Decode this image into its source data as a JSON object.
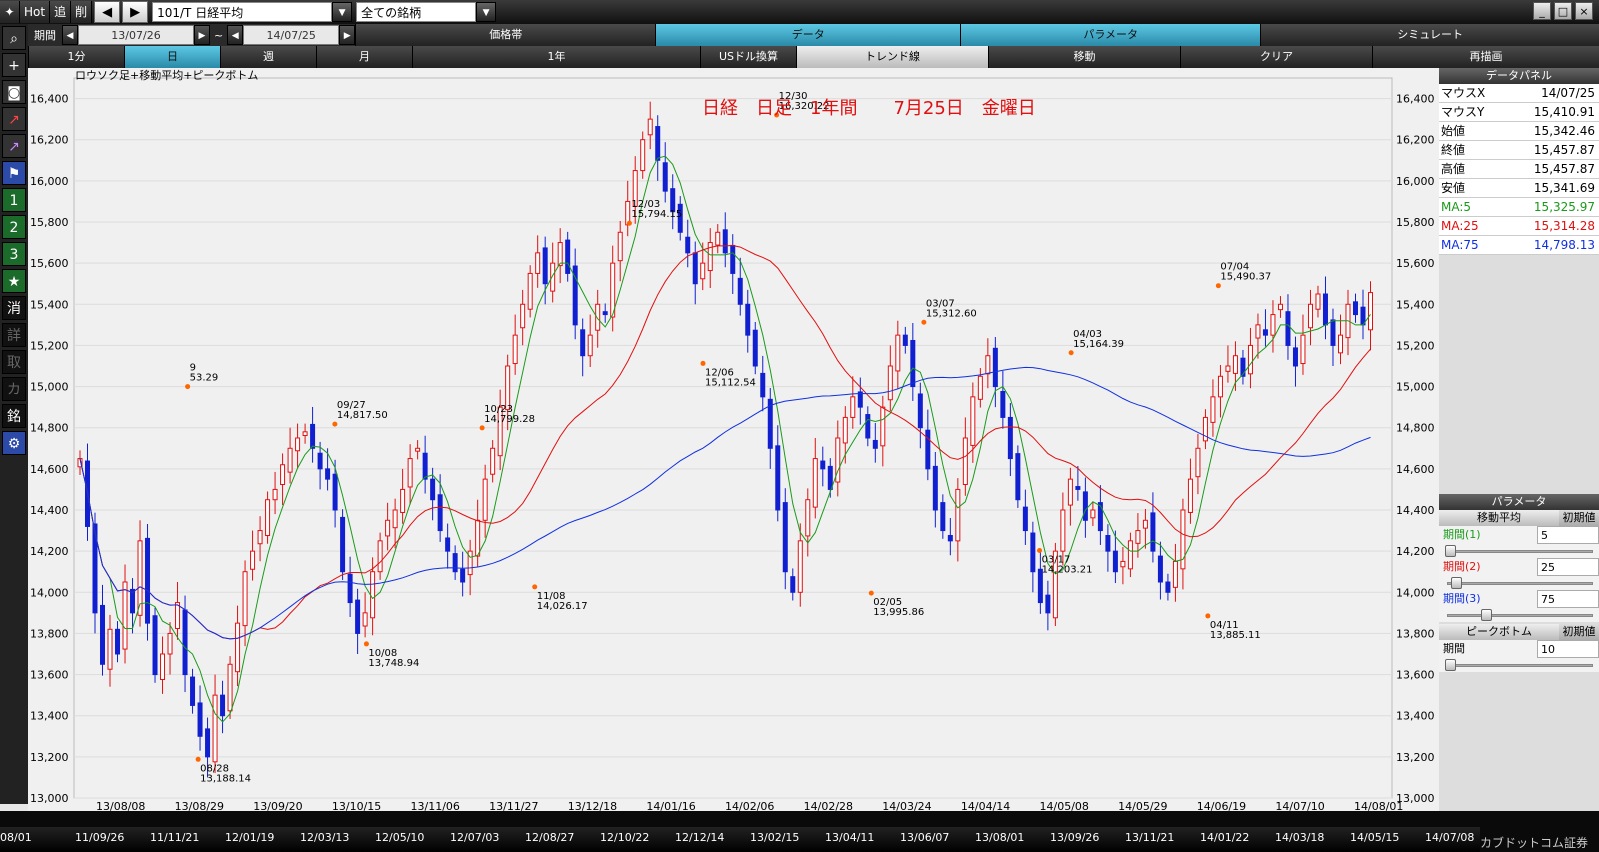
{
  "toolbar": {
    "hot": "Hot",
    "add": "追",
    "del": "削",
    "symbol": "101/T 日経平均",
    "list": "全ての銘柄"
  },
  "range": {
    "label": "期間",
    "from": "13/07/26",
    "tilde": "~",
    "to": "14/07/25"
  },
  "tabs_top": [
    "価格帯",
    "データ",
    "パラメータ",
    "シミュレート"
  ],
  "tabs_bottom": [
    "1分",
    "日",
    "週",
    "月",
    "1年",
    "USドル換算",
    "トレンド線",
    "移動",
    "クリア",
    "再描画"
  ],
  "sidebar": [
    "1",
    "2",
    "3",
    "★",
    "消",
    "詳",
    "取",
    "カ",
    "銘"
  ],
  "chart": {
    "caption": "ロウソク足+移動平均+ピークボトム",
    "title": "日経　日足　1年間　　7月25日　金曜日",
    "y_ticks": [
      "16,400",
      "16,200",
      "16,000",
      "15,800",
      "15,600",
      "15,400",
      "15,200",
      "15,000",
      "14,800",
      "14,600",
      "14,400",
      "14,200",
      "14,000",
      "13,800",
      "13,600",
      "13,400",
      "13,200",
      "13,000"
    ],
    "x_ticks": [
      "13/08/08",
      "13/08/29",
      "13/09/20",
      "13/10/15",
      "13/11/06",
      "13/11/27",
      "13/12/18",
      "14/01/16",
      "14/02/06",
      "14/02/28",
      "14/03/24",
      "14/04/14",
      "14/05/08",
      "14/05/29",
      "14/06/19",
      "14/07/10",
      "14/08/01"
    ],
    "peaks": [
      {
        "date": "9",
        "value": "53.29"
      },
      {
        "date": "09/27",
        "value": "14,817.50"
      },
      {
        "date": "10/23",
        "value": "14,799.28"
      },
      {
        "date": "12/03",
        "value": "15,794.15"
      },
      {
        "date": "12/30",
        "value": "16,320.22"
      },
      {
        "date": "03/07",
        "value": "15,312.60"
      },
      {
        "date": "04/03",
        "value": "15,164.39"
      },
      {
        "date": "07/04",
        "value": "15,490.37"
      }
    ],
    "bottoms": [
      {
        "date": "08/28",
        "value": "13,188.14"
      },
      {
        "date": "10/08",
        "value": "13,748.94"
      },
      {
        "date": "11/08",
        "value": "14,026.17"
      },
      {
        "date": "12/06",
        "value": "15,112.54"
      },
      {
        "date": "02/05",
        "value": "13,995.86"
      },
      {
        "date": "03/17",
        "value": "14,203.21"
      },
      {
        "date": "04/11",
        "value": "13,885.11"
      }
    ]
  },
  "data_panel": {
    "title": "データパネル",
    "rows": [
      {
        "k": "マウスX",
        "v": "14/07/25"
      },
      {
        "k": "マウスY",
        "v": "15,410.91"
      },
      {
        "k": "始値",
        "v": "15,342.46"
      },
      {
        "k": "終値",
        "v": "15,457.87"
      },
      {
        "k": "高値",
        "v": "15,457.87"
      },
      {
        "k": "安値",
        "v": "15,341.69"
      },
      {
        "k": "MA:5",
        "v": "15,325.97",
        "color": "#1a9a1a"
      },
      {
        "k": "MA:25",
        "v": "15,314.28",
        "color": "#e01010"
      },
      {
        "k": "MA:75",
        "v": "14,798.13",
        "color": "#1030e0"
      }
    ]
  },
  "param_panel": {
    "title": "パラメータ",
    "ma_label": "移動平均",
    "reset": "初期値",
    "p1_label": "期間(1)",
    "p1": "5",
    "p2_label": "期間(2)",
    "p2": "25",
    "p3_label": "期間(3)",
    "p3": "75",
    "pb_label": "ピークボトム",
    "pb_reset": "初期値",
    "pb_period_label": "期間",
    "pb_period": "10"
  },
  "timeline": [
    "08/01",
    "11/09/26",
    "11/11/21",
    "12/01/19",
    "12/03/13",
    "12/05/10",
    "12/07/03",
    "12/08/27",
    "12/10/22",
    "12/12/14",
    "13/02/15",
    "13/04/11",
    "13/06/07",
    "13/08/01",
    "13/09/26",
    "13/11/21",
    "14/01/22",
    "14/03/18",
    "14/05/15",
    "14/07/08"
  ],
  "brand": "カブドットコム証券",
  "chart_data": {
    "type": "candlestick",
    "title": "日経　日足　1年間　　7月25日　金曜日",
    "ylim": [
      13000,
      16500
    ],
    "series": [
      {
        "name": "MA:5",
        "color": "#1a9a1a"
      },
      {
        "name": "MA:25",
        "color": "#e01010"
      },
      {
        "name": "MA:75",
        "color": "#1030e0"
      }
    ],
    "closes": [
      14650,
      14320,
      13900,
      13650,
      13820,
      13700,
      14050,
      13900,
      14250,
      13850,
      13600,
      13700,
      13800,
      13950,
      13600,
      13450,
      13300,
      13200,
      13500,
      13400,
      13650,
      13850,
      14100,
      14200,
      14300,
      14450,
      14500,
      14620,
      14700,
      14750,
      14780,
      14700,
      14600,
      14550,
      14400,
      14100,
      13950,
      13800,
      13900,
      14100,
      14250,
      14350,
      14400,
      14500,
      14650,
      14700,
      14550,
      14450,
      14300,
      14200,
      14100,
      14050,
      14200,
      14350,
      14550,
      14700,
      14900,
      15100,
      15250,
      15400,
      15550,
      15650,
      15500,
      15600,
      15700,
      15550,
      15300,
      15150,
      15250,
      15400,
      15350,
      15600,
      15750,
      15900,
      16050,
      16200,
      16300,
      16100,
      15950,
      15850,
      15750,
      15650,
      15500,
      15600,
      15700,
      15750,
      15650,
      15550,
      15400,
      15250,
      15100,
      14950,
      14700,
      14400,
      14100,
      14000,
      14250,
      14450,
      14650,
      14600,
      14500,
      14750,
      14850,
      14950,
      14900,
      14750,
      14700,
      14900,
      15100,
      15250,
      15200,
      15000,
      14800,
      14600,
      14400,
      14300,
      14250,
      14500,
      14750,
      14950,
      15050,
      15150,
      15000,
      14850,
      14650,
      14450,
      14300,
      14100,
      13950,
      13900,
      14200,
      14400,
      14550,
      14500,
      14350,
      14400,
      14300,
      14200,
      14100,
      14150,
      14250,
      14300,
      14350,
      14200,
      14050,
      14000,
      14150,
      14400,
      14550,
      14700,
      14850,
      14950,
      15050,
      15100,
      15150,
      15050,
      15200,
      15300,
      15250,
      15350,
      15400,
      15200,
      15100,
      15250,
      15400,
      15450,
      15300,
      15200,
      15250,
      15400,
      15350,
      15300,
      15457
    ]
  }
}
